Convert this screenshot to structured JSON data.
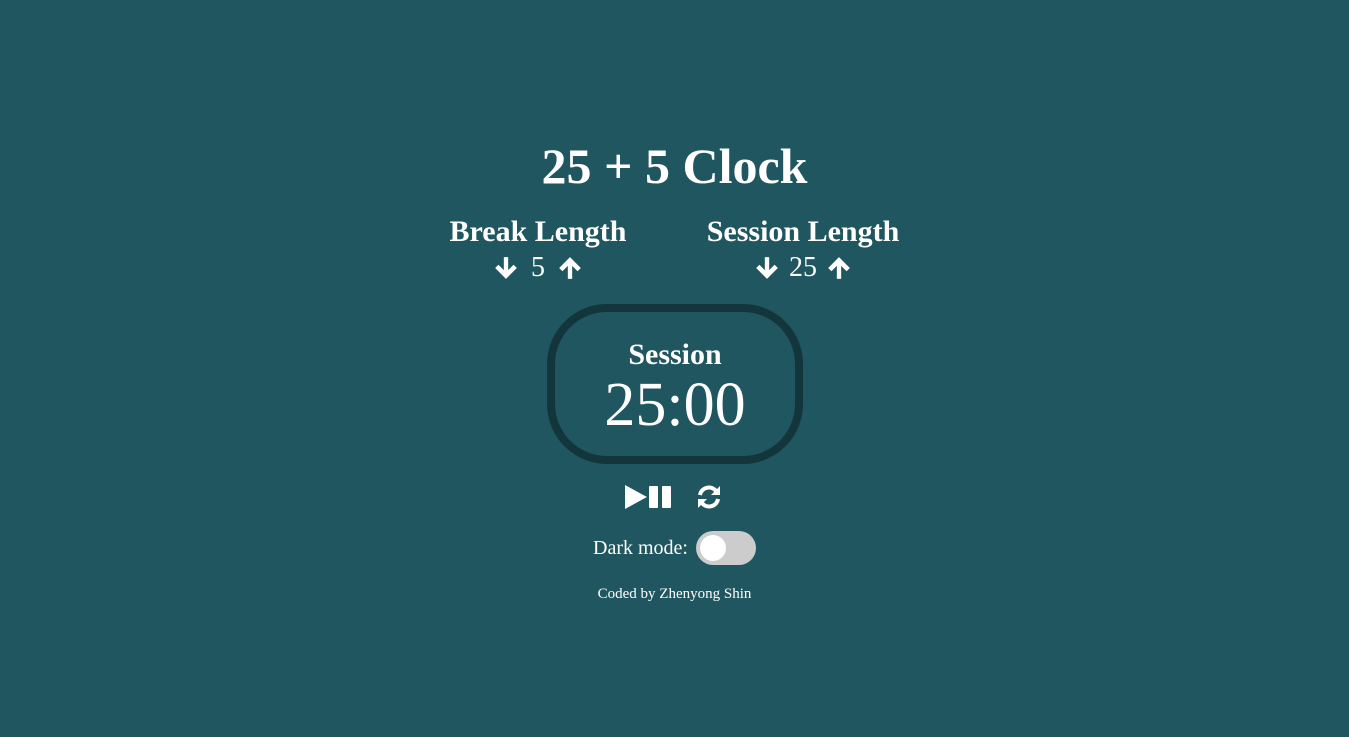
{
  "app": {
    "title": "25 + 5 Clock"
  },
  "break": {
    "label": "Break Length",
    "value": "5",
    "decrement_icon": "arrow-down-icon",
    "increment_icon": "arrow-up-icon"
  },
  "session": {
    "label": "Session Length",
    "value": "25",
    "decrement_icon": "arrow-down-icon",
    "increment_icon": "arrow-up-icon"
  },
  "timer": {
    "label": "Session",
    "time_left": "25:00"
  },
  "controls": {
    "start_stop_icon": "play-pause-icon",
    "reset_icon": "refresh-icon"
  },
  "dark_mode": {
    "label": "Dark mode:",
    "enabled": false
  },
  "footer": {
    "credit": "Coded by Zhenyong Shin"
  },
  "colors": {
    "background": "#20565f",
    "timer_border": "#12363b",
    "text": "#ffffff",
    "toggle_track": "#cccccc"
  }
}
